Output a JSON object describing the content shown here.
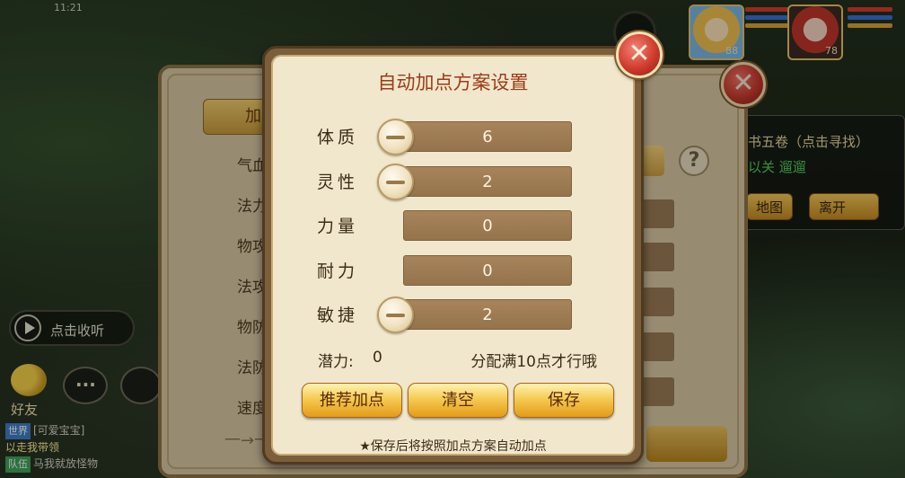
{
  "status_bar": {
    "time": "11:21"
  },
  "heroes": [
    {
      "level": "88",
      "portrait": "blonde-hero"
    },
    {
      "level": "78",
      "portrait": "redhair-hero"
    }
  ],
  "quest": {
    "title": "书五卷（点击寻找）",
    "subtitle": "以关 遛遛",
    "btn_map": "地图",
    "btn_leave": "离开"
  },
  "voice_button": {
    "label": "点击收听"
  },
  "friends": {
    "label": "好友"
  },
  "chat_log": [
    {
      "tag": "世界",
      "text": "[可爱宝宝]",
      "extra": ""
    },
    {
      "tag": "",
      "text": "以走我带领",
      "extra": ""
    },
    {
      "tag": "队伍",
      "text": "马我就放怪物",
      "extra": ""
    }
  ],
  "bg_panel": {
    "tab_label": "加点",
    "stats": [
      "气血",
      "法力",
      "物攻",
      "法攻",
      "物防",
      "法防",
      "速度"
    ],
    "bottom_text": "一→一"
  },
  "dialog": {
    "title": "自动加点方案设置",
    "attributes": [
      {
        "name": "体质",
        "value": "6",
        "has_minus": true
      },
      {
        "name": "灵性",
        "value": "2",
        "has_minus": true
      },
      {
        "name": "力量",
        "value": "0",
        "has_minus": false
      },
      {
        "name": "耐力",
        "value": "0",
        "has_minus": false
      },
      {
        "name": "敏捷",
        "value": "2",
        "has_minus": true
      }
    ],
    "potential_label": "潜力:",
    "potential_value": "0",
    "hint": "分配满10点才行哦",
    "buttons": {
      "recommend": "推荐加点",
      "clear": "清空",
      "save": "保存"
    },
    "footer_note": "★保存后将按照加点方案自动加点"
  },
  "colors": {
    "title": "#9b3c18",
    "dialog_bg": "#f1e7cc",
    "bar": "#a8845a",
    "gold_button": "#f5cb53",
    "close_red": "#cf3b2c"
  }
}
